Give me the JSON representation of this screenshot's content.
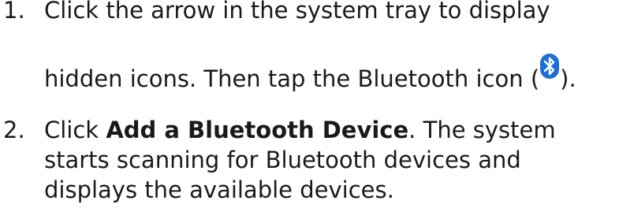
{
  "steps": [
    {
      "number": "1.",
      "line1": "Click the arrow in the system tray to display",
      "line2_before": "hidden icons. Then tap the Bluetooth icon (",
      "line2_after": ").",
      "icon": "bluetooth-icon",
      "icon_color": "#1f6fd6"
    },
    {
      "number": "2.",
      "line1_before": "Click ",
      "line1_bold": "Add a Bluetooth Device",
      "line1_after": ". The system",
      "line2": "starts scanning for Bluetooth devices and",
      "line3": "displays the available devices."
    }
  ]
}
